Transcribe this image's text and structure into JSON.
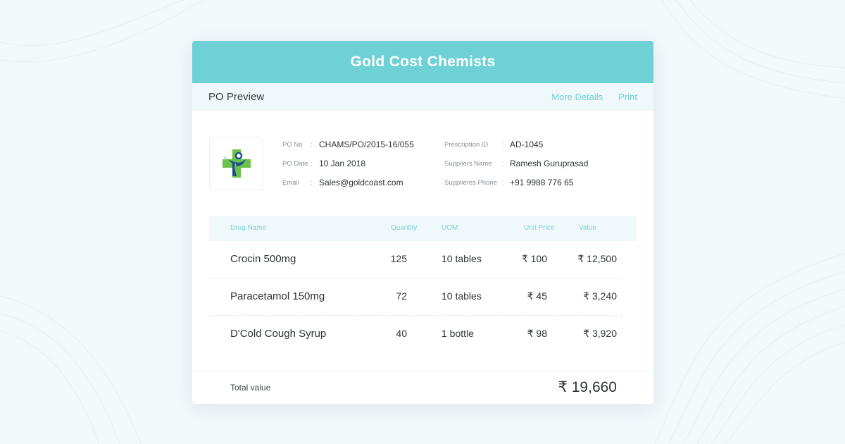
{
  "header": {
    "title": "Gold Cost Chemists"
  },
  "subbar": {
    "title": "PO Preview",
    "more_details": "More Details",
    "print": "Print"
  },
  "info": {
    "left": [
      {
        "label": "PO No",
        "sep": ":",
        "value": "CHAMS/PO/2015-16/055"
      },
      {
        "label": "PO Date",
        "sep": ":",
        "value": "10 Jan 2018"
      },
      {
        "label": "Email",
        "sep": ":",
        "value": "Sales@goldcoast.com"
      }
    ],
    "right": [
      {
        "label": "Prescription ID",
        "sep": ":",
        "value": "AD-1045"
      },
      {
        "label": "Suppliers Name",
        "sep": ":",
        "value": "Ramesh Guruprasad"
      },
      {
        "label": "Supplieres Phone",
        "sep": ":",
        "value": "+91 9988 776 65"
      }
    ]
  },
  "table": {
    "headers": {
      "drug_name": "Drug Name",
      "quantity": "Quantity",
      "uom": "UOM",
      "unit_price": "Unit Price",
      "value": "Value"
    },
    "rows": [
      {
        "drug_name": "Crocin 500mg",
        "quantity": "125",
        "uom": "10 tables",
        "unit_price": "₹ 100",
        "value": "₹ 12,500"
      },
      {
        "drug_name": "Paracetamol 150mg",
        "quantity": "72",
        "uom": "10 tables",
        "unit_price": "₹ 45",
        "value": "₹ 3,240"
      },
      {
        "drug_name": "D'Cold Cough Syrup",
        "quantity": "40",
        "uom": "1 bottle",
        "unit_price": "₹ 98",
        "value": "₹ 3,920"
      }
    ]
  },
  "footer": {
    "label": "Total value",
    "total": "₹ 19,660"
  },
  "colors": {
    "accent": "#6dd1d5",
    "logo_green": "#6cc24a",
    "logo_blue": "#1d4f91"
  },
  "icons": {
    "logo": "pharmacy-cross-logo"
  }
}
